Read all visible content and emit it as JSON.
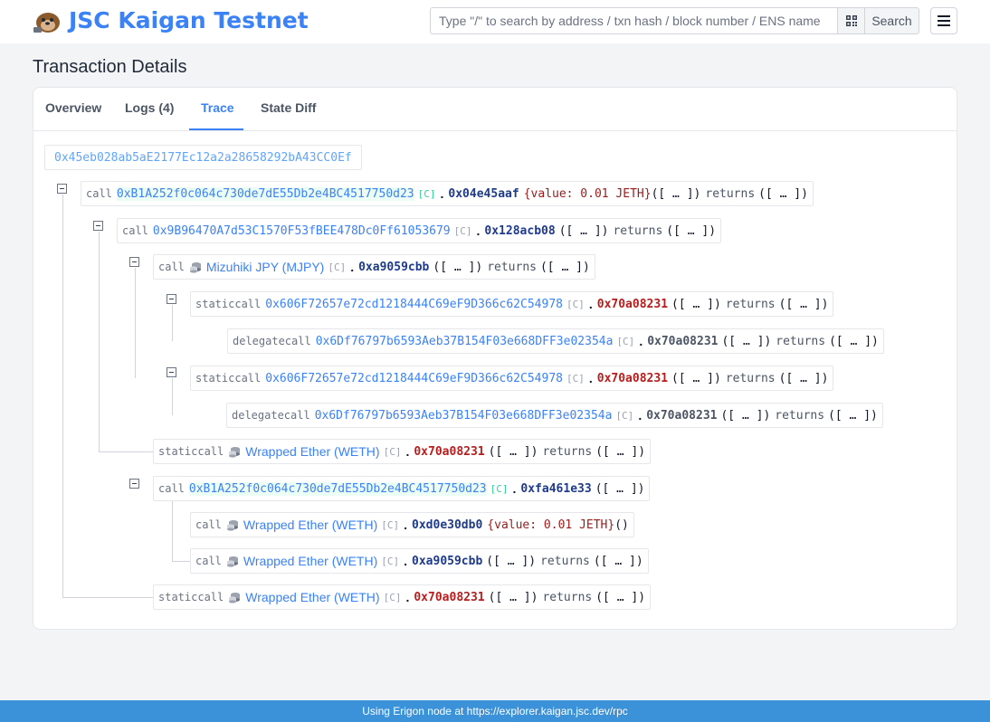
{
  "header": {
    "brand": "JSC Kaigan Testnet",
    "search_placeholder": "Type \"/\" to search by address / txn hash / block number / ENS name",
    "search_button": "Search",
    "icons": {
      "logo": "otter-logo",
      "qr": "qr-code-icon",
      "menu": "hamburger-menu-icon"
    }
  },
  "page": {
    "title": "Transaction Details"
  },
  "tabs": [
    {
      "label": "Overview",
      "active": false
    },
    {
      "label": "Logs (4)",
      "active": true
    },
    {
      "label": "Trace",
      "active": true
    },
    {
      "label": "State Diff",
      "active": false
    }
  ],
  "trace": {
    "from": "0x45eb028ab5aE2177Ec12a2a28658292bA43CC0Ef",
    "nodes": [
      {
        "type": "call",
        "target": "0xB1A252f0c064c730de7dE55Db2e4BC4517750d23",
        "contract": "[C]",
        "selector": "0x04e45aaf",
        "value": "{value: 0.01 JETH}",
        "params": "([ … ])",
        "returns": "returns",
        "ret_params": "([ … ])"
      },
      {
        "type": "call",
        "target": "0x9B96470A7d53C1570F53fBEE478Dc0Ff61053679",
        "contract": "[C]",
        "selector": "0x128acb08",
        "params": "([ … ])",
        "returns": "returns",
        "ret_params": "([ … ])"
      },
      {
        "type": "call",
        "target": "Mizuhiki JPY (MJPY)",
        "contract": "[C]",
        "selector": "0xa9059cbb",
        "params": "([ … ])",
        "returns": "returns",
        "ret_params": "([ … ])"
      },
      {
        "type": "staticcall",
        "target": "0x606F72657e72cd1218444C69eF9D366c62C54978",
        "contract": "[C]",
        "selector": "0x70a08231",
        "params": "([ … ])",
        "returns": "returns",
        "ret_params": "([ … ])"
      },
      {
        "type": "delegatecall",
        "target": "0x6Df76797b6593Aeb37B154F03e668DFF3e02354a",
        "contract": "[C]",
        "selector": "0x70a08231",
        "params": "([ … ])",
        "returns": "returns",
        "ret_params": "([ … ])"
      },
      {
        "type": "staticcall",
        "target": "0x606F72657e72cd1218444C69eF9D366c62C54978",
        "contract": "[C]",
        "selector": "0x70a08231",
        "params": "([ … ])",
        "returns": "returns",
        "ret_params": "([ … ])"
      },
      {
        "type": "delegatecall",
        "target": "0x6Df76797b6593Aeb37B154F03e668DFF3e02354a",
        "contract": "[C]",
        "selector": "0x70a08231",
        "params": "([ … ])",
        "returns": "returns",
        "ret_params": "([ … ])"
      },
      {
        "type": "staticcall",
        "target": "Wrapped Ether (WETH)",
        "contract": "[C]",
        "selector": "0x70a08231",
        "params": "([ … ])",
        "returns": "returns",
        "ret_params": "([ … ])"
      },
      {
        "type": "call",
        "target": "0xB1A252f0c064c730de7dE55Db2e4BC4517750d23",
        "contract": "[C]",
        "selector": "0xfa461e33",
        "params": "([ … ])"
      },
      {
        "type": "call",
        "target": "Wrapped Ether (WETH)",
        "contract": "[C]",
        "selector": "0xd0e30db0",
        "value": "{value: 0.01 JETH}",
        "params": "()"
      },
      {
        "type": "call",
        "target": "Wrapped Ether (WETH)",
        "contract": "[C]",
        "selector": "0xa9059cbb",
        "params": "([ … ])",
        "returns": "returns",
        "ret_params": "([ … ])"
      },
      {
        "type": "staticcall",
        "target": "Wrapped Ether (WETH)",
        "contract": "[C]",
        "selector": "0x70a08231",
        "params": "([ … ])",
        "returns": "returns",
        "ret_params": "([ … ])"
      }
    ]
  },
  "footer": {
    "text": "Using Erigon node at https://explorer.kaigan.jsc.dev/rpc"
  },
  "colors": {
    "accent": "#3b82f6",
    "footer": "#3b92d8",
    "selector_red": "#b91c1c",
    "selector_navy": "#1e3a8a"
  }
}
